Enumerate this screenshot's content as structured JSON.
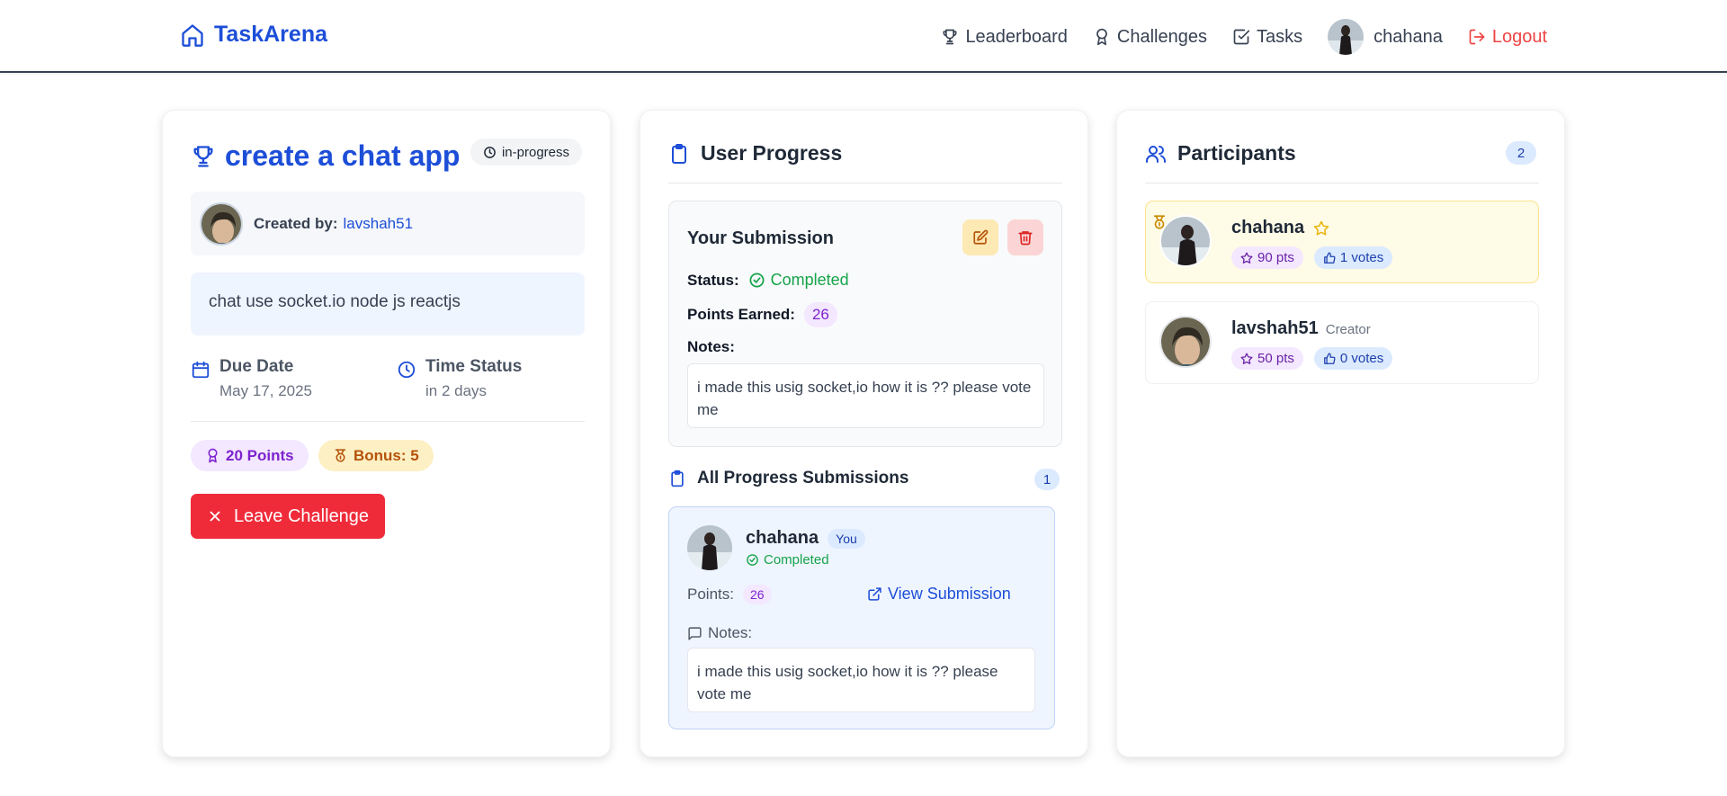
{
  "nav": {
    "brand": "TaskArena",
    "leaderboard": "Leaderboard",
    "challenges": "Challenges",
    "tasks": "Tasks",
    "username": "chahana",
    "logout": "Logout"
  },
  "challenge": {
    "title": "create a chat app",
    "status": "in-progress",
    "created_by_label": "Created by:",
    "creator": "lavshah51",
    "description": "chat use socket.io node js reactjs",
    "due_label": "Due Date",
    "due_value": "May 17, 2025",
    "time_label": "Time Status",
    "time_value": "in 2 days",
    "points": "20 Points",
    "bonus": "Bonus: 5",
    "leave_button": "Leave Challenge"
  },
  "progress": {
    "heading": "User Progress",
    "your_submission": "Your Submission",
    "status_label": "Status:",
    "status_value": "Completed",
    "points_label": "Points Earned:",
    "points_value": "26",
    "notes_label": "Notes:",
    "notes_value": "i made this usig socket,io how it is ?? please vote me",
    "all_heading": "All Progress Submissions",
    "all_count": "1",
    "entries": [
      {
        "name": "chahana",
        "you_tag": "You",
        "status": "Completed",
        "points_label": "Points:",
        "points": "26",
        "view_link": "View Submission",
        "notes_label": "Notes:",
        "notes": "i made this usig socket,io how it is ?? please vote me"
      }
    ]
  },
  "participants": {
    "heading": "Participants",
    "count": "2",
    "list": [
      {
        "name": "chahana",
        "tag": "",
        "pts": "90 pts",
        "votes": "1 votes"
      },
      {
        "name": "lavshah51",
        "tag": "Creator",
        "pts": "50 pts",
        "votes": "0 votes"
      }
    ]
  },
  "colors": {
    "brand": "#1d4ed8",
    "danger": "#ef2b3a",
    "success": "#16a34a",
    "points": "#7e22ce",
    "bonus": "#b45309"
  }
}
